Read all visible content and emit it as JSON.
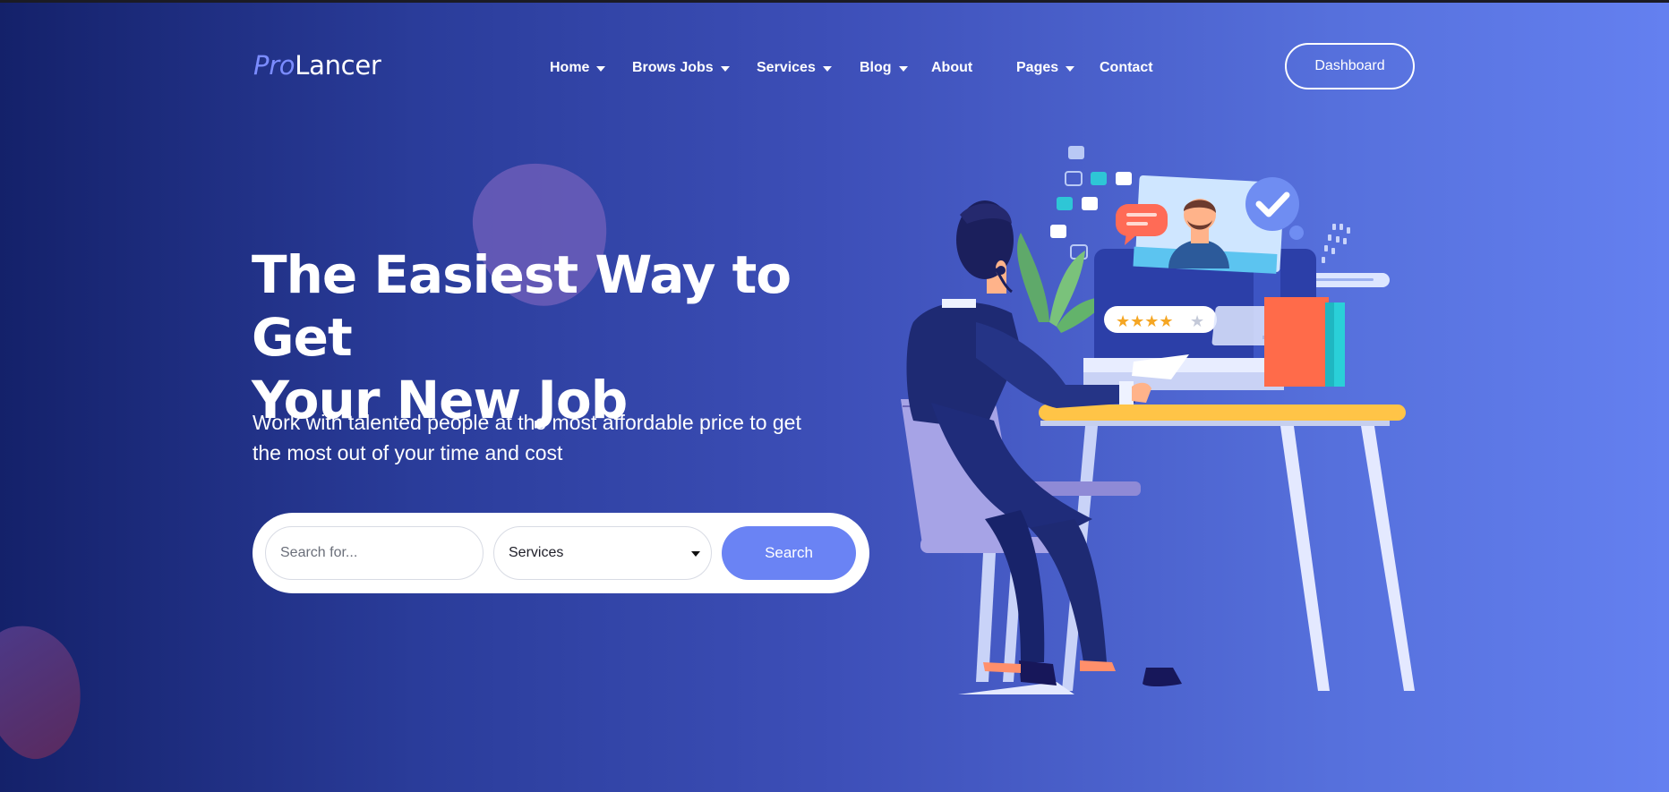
{
  "brand": {
    "logo_prefix": "Pro",
    "logo_suffix": "Lancer"
  },
  "nav": {
    "items": [
      {
        "label": "Home",
        "dropdown": true
      },
      {
        "label": "Brows Jobs",
        "dropdown": true
      },
      {
        "label": "Services",
        "dropdown": true
      },
      {
        "label": "Blog",
        "dropdown": true
      },
      {
        "label": "About",
        "dropdown": false
      },
      {
        "label": "Pages",
        "dropdown": true
      },
      {
        "label": "Contact",
        "dropdown": false
      }
    ],
    "dashboard_label": "Dashboard"
  },
  "hero": {
    "title_line1": "The Easiest Way to Get",
    "title_line2": "Your New Job",
    "subtitle_line1": "Work with talented people at the most affordable price to get",
    "subtitle_line2": "the most out of your time and cost"
  },
  "search": {
    "placeholder": "Search for...",
    "category_value": "Services",
    "button_label": "Search"
  },
  "colors": {
    "accent": "#6a83f4",
    "logo_accent": "#7b8cff",
    "bg_left": "#14216a",
    "bg_right": "#6480f0"
  }
}
